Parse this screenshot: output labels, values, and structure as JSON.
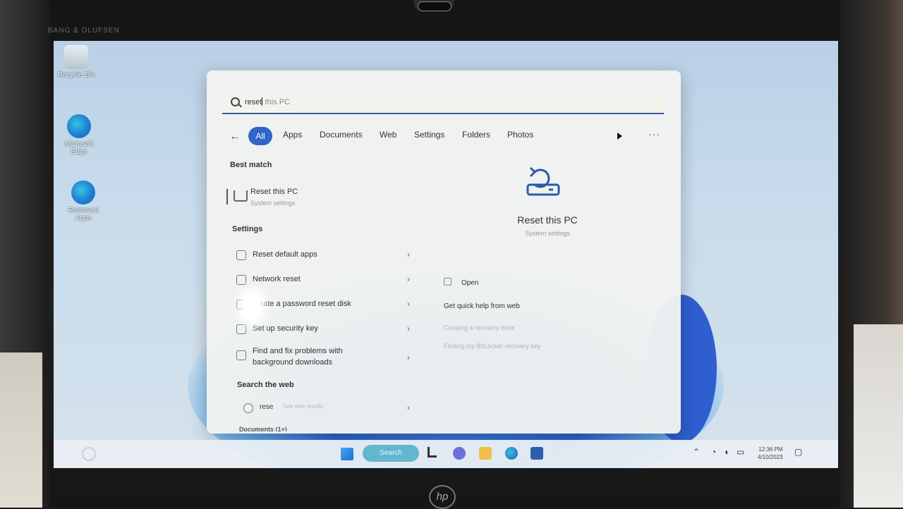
{
  "bezel": {
    "brand": "BANG & OLUFSEN",
    "logo": "hp"
  },
  "desktop": {
    "icons": [
      {
        "label": "Recycle Bin",
        "icon": "recycle-bin-icon"
      },
      {
        "label": "Microsoft Edge",
        "icon": "edge-icon"
      },
      {
        "label": "Removed Apps",
        "icon": "edge-icon"
      }
    ]
  },
  "search": {
    "query_typed": "reset",
    "query_suggest": " this PC",
    "filters": [
      "All",
      "Apps",
      "Documents",
      "Web",
      "Settings",
      "Folders",
      "Photos"
    ],
    "active_filter": "All",
    "best_match": {
      "heading": "Best match",
      "title": "Reset this PC",
      "subtitle": "System settings"
    },
    "settings": {
      "heading": "Settings",
      "items": [
        "Reset default apps",
        "Network reset",
        "eate a password reset disk",
        "Set up security key",
        "Find and fix problems with background downloads"
      ]
    },
    "web": {
      "heading": "Search the web",
      "query": "rese",
      "hint": "See web results"
    },
    "cut_off_heading": "Documents (1+)",
    "preview": {
      "title": "Reset this PC",
      "subtitle": "System settings",
      "actions": [
        "Open",
        "Get quick help from web",
        "Creating a recovery drive",
        "Finding my BitLocker recovery key"
      ]
    }
  },
  "taskbar": {
    "search_label": "Search",
    "clock_time": "12:36 PM",
    "clock_date": "4/10/2023"
  },
  "colors": {
    "accent": "#2e66c9",
    "taskbar_search": "#61b7cf",
    "desktop": "#c9dcec"
  }
}
